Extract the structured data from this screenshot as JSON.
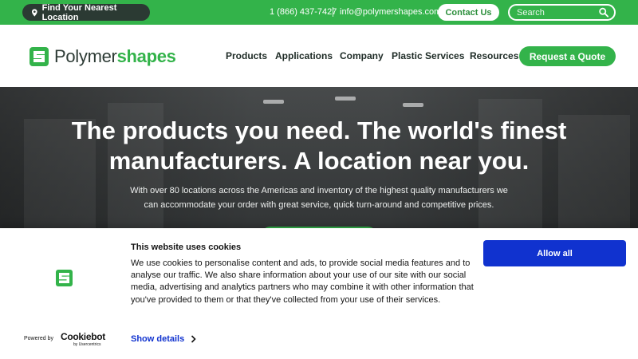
{
  "topbar": {
    "location_label": "Find Your Nearest Location",
    "phone": "1 (866) 437-7427",
    "email": "info@polymershapes.com",
    "contact_label": "Contact Us",
    "search_placeholder": "Search"
  },
  "brand": {
    "name_part1": "Polymer",
    "name_part2": "shapes",
    "green": "#33b34a",
    "dark": "#2b3a33"
  },
  "nav": {
    "items": [
      "Products",
      "Applications",
      "Company",
      "Plastic Services",
      "Resources"
    ],
    "quote_label": "Request a Quote"
  },
  "hero": {
    "title_line1": "The products you need. The world's finest",
    "title_line2": "manufacturers. A location near you.",
    "subtitle_line1": "With over 80 locations across the Americas and inventory of the highest quality manufacturers we",
    "subtitle_line2": "can accommodate your order with great service, quick turn-around and competitive prices."
  },
  "cookie": {
    "title": "This website uses cookies",
    "body": "We use cookies to personalise content and ads, to provide social media features and to analyse our traffic. We also share information about your use of our site with our social media, advertising and analytics partners who may combine it with other information that you've provided to them or that they've collected from your use of their services.",
    "allow_label": "Allow all",
    "show_details_label": "Show details",
    "powered_by": "Powered by",
    "cookiebot": "Cookiebot",
    "usercentrics": "by Usercentrics",
    "accent": "#1032cf"
  }
}
